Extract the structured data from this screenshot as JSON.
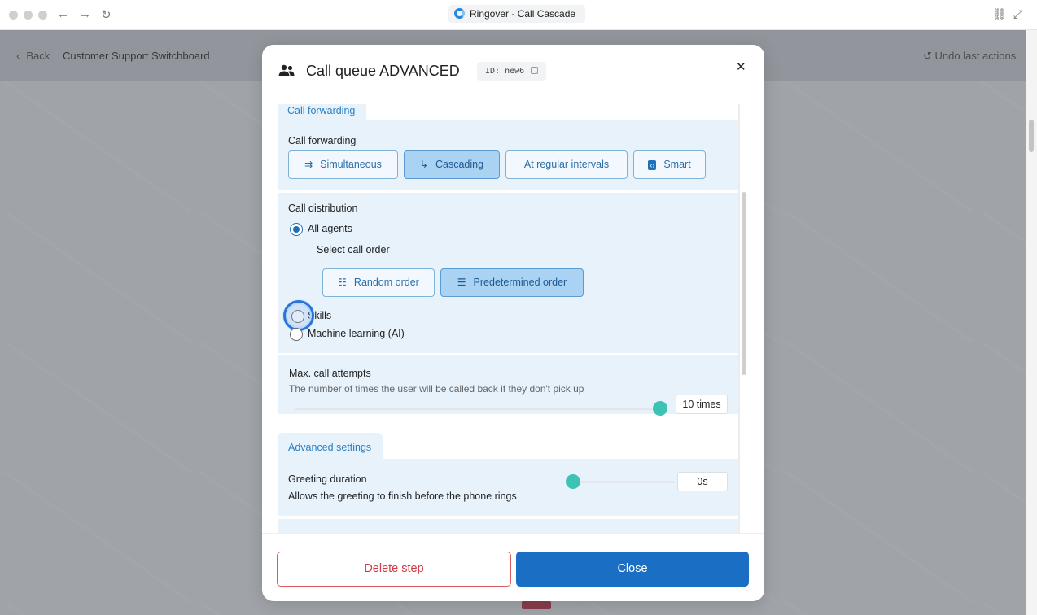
{
  "browser": {
    "tab_title": "Ringover - Call Cascade"
  },
  "app": {
    "back_label": "Back",
    "breadcrumb": "Customer Support Switchboard",
    "undo_label": "Undo last actions"
  },
  "modal": {
    "title": "Call queue ADVANCED",
    "id_label": "ID: new6",
    "forwarding_tab": "Call forwarding",
    "forwarding_label": "Call forwarding",
    "forwarding_options": [
      {
        "label": "Simultaneous",
        "icon": "simultaneous-icon",
        "active": false
      },
      {
        "label": "Cascading",
        "icon": "cascade-icon",
        "active": true
      },
      {
        "label": "At regular intervals",
        "icon": "",
        "active": false
      },
      {
        "label": "Smart",
        "icon": "code-icon",
        "active": false
      }
    ],
    "distribution_label": "Call distribution",
    "distribution_options": [
      {
        "label": "All agents",
        "checked": true
      },
      {
        "label": "Skills",
        "checked": false
      },
      {
        "label": "Machine learning (AI)",
        "checked": false
      }
    ],
    "call_order_label": "Select call order",
    "call_order_options": [
      {
        "label": "Random order",
        "active": false
      },
      {
        "label": "Predetermined order",
        "active": true
      }
    ],
    "max_attempts": {
      "label": "Max. call attempts",
      "description": "The number of times the user will be called back if they don't pick up",
      "value": "10 times"
    },
    "advanced_tab": "Advanced settings",
    "greeting": {
      "label": "Greeting duration",
      "description": "Allows the greeting to finish before the phone rings",
      "value": "0s"
    },
    "delete_label": "Delete step",
    "close_label": "Close"
  },
  "colors": {
    "accent": "#1a6fc4",
    "danger": "#d23a44",
    "slider": "#3cc3b4",
    "panel": "#e7f2fb"
  }
}
